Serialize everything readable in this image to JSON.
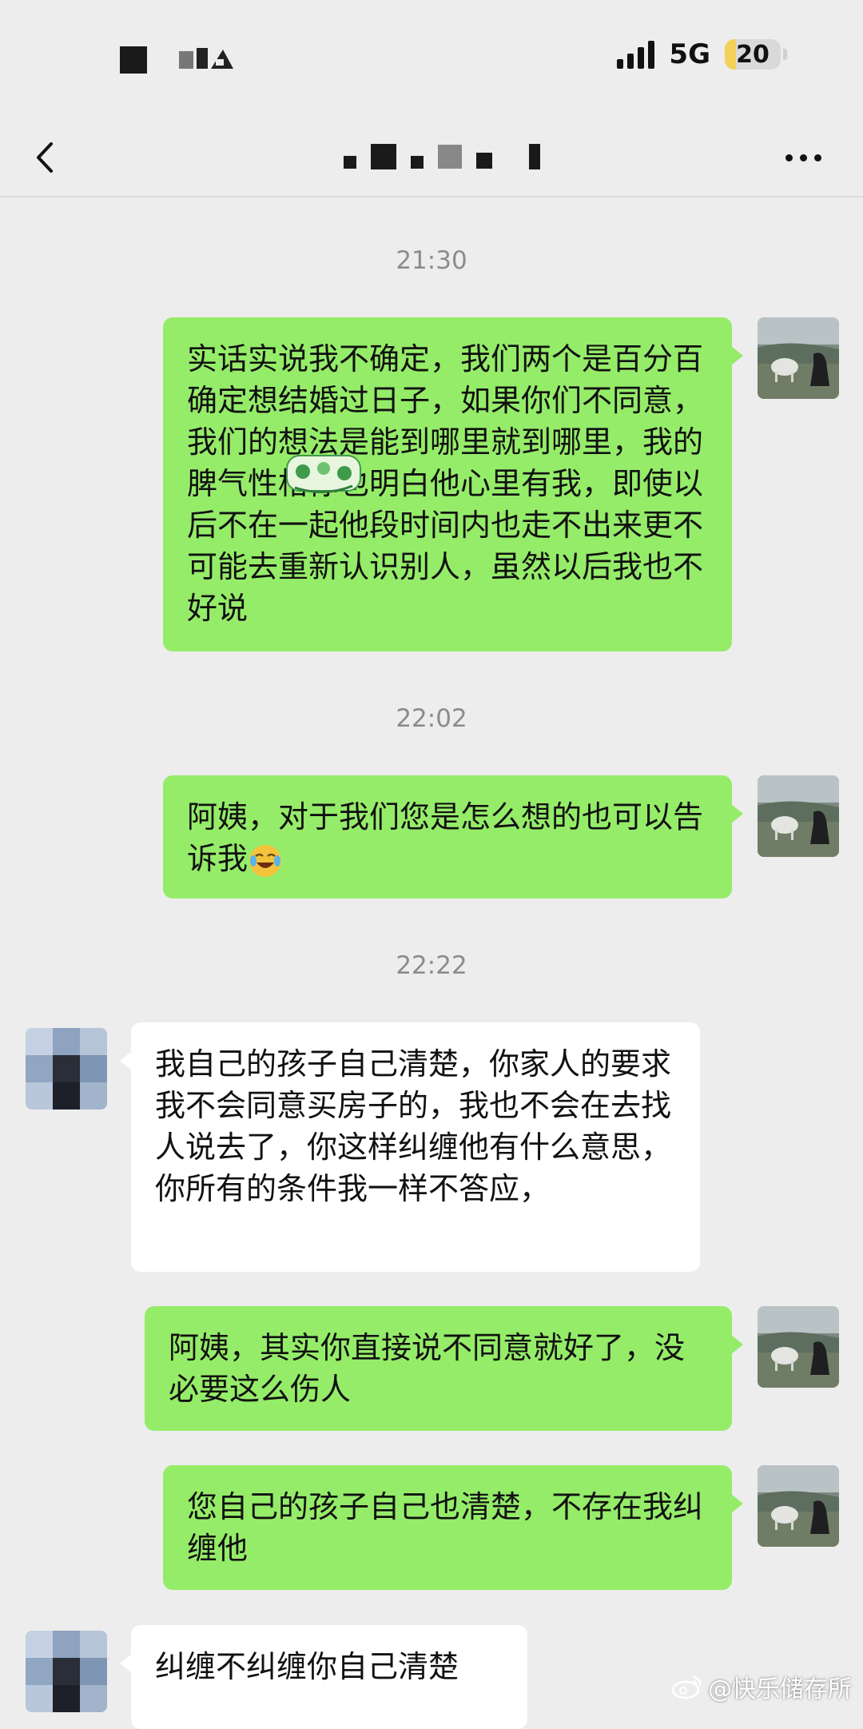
{
  "status_bar": {
    "network": "5G",
    "battery": "20",
    "battery_percent": 20,
    "icons": [
      "signal-icon",
      "battery-icon"
    ]
  },
  "nav": {
    "icons": [
      "back-icon",
      "more-icon"
    ]
  },
  "chat": {
    "timestamps": [
      "21:30",
      "22:02",
      "22:22"
    ],
    "messages": [
      {
        "sender": "self",
        "text": "实话实说我不确定，我们两个是百分百确定想结婚过日子，如果你们不同意，我们的想法是能到哪里就到哪里，我的脾气性格你也明白他心里有我，即使以后不在一起他段时间内也走不出来更不可能去重新认识别人，虽然以后我也不好说"
      },
      {
        "sender": "self",
        "text": "阿姨，对于我们您是怎么想的也可以告诉我",
        "emoji": "crying-laughing-emoji-icon"
      },
      {
        "sender": "other",
        "text": "我自己的孩子自己清楚，你家人的要求我不会同意买房子的，我也不会在去找人说去了，你这样纠缠他有什么意思，你所有的条件我一样不答应，"
      },
      {
        "sender": "self",
        "text": "阿姨，其实你直接说不同意就好了，没必要这么伤人"
      },
      {
        "sender": "self",
        "text": "您自己的孩子自己也清楚，不存在我纠缠他"
      },
      {
        "sender": "other",
        "text": "纠缠不纠缠你自己清楚"
      }
    ]
  },
  "watermark": {
    "text": "@快乐储存所",
    "icon": "weibo-icon"
  },
  "colors": {
    "background": "#ededed",
    "self_bubble": "#95ec69",
    "other_bubble": "#ffffff",
    "timestamp": "#8c8c8c"
  }
}
